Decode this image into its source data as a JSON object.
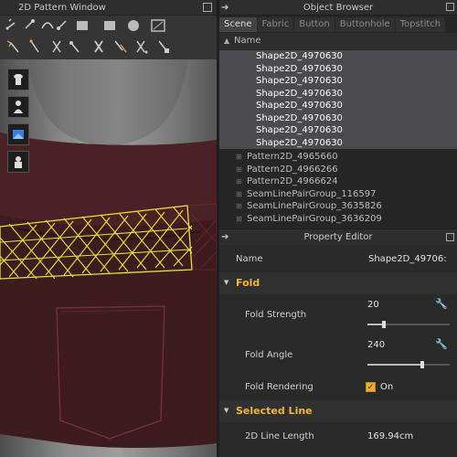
{
  "left_window": {
    "title": "2D Pattern Window"
  },
  "object_browser": {
    "title": "Object Browser",
    "tabs": [
      {
        "label": "Scene",
        "active": true
      },
      {
        "label": "Fabric",
        "active": false
      },
      {
        "label": "Button",
        "active": false
      },
      {
        "label": "Buttonhole",
        "active": false
      },
      {
        "label": "Topstitch",
        "active": false
      }
    ],
    "column_header": "Name",
    "selected_items": [
      "Shape2D_4970630",
      "Shape2D_4970630",
      "Shape2D_4970630",
      "Shape2D_4970630",
      "Shape2D_4970630",
      "Shape2D_4970630",
      "Shape2D_4970630",
      "Shape2D_4970630"
    ],
    "items": [
      "Pattern2D_4965660",
      "Pattern2D_4966266",
      "Pattern2D_4966624",
      "SeamLinePairGroup_116597",
      "SeamLinePairGroup_3635826",
      "SeamLinePairGroup_3636209"
    ]
  },
  "property_editor": {
    "title": "Property Editor",
    "name_label": "Name",
    "name_value": "Shape2D_49706:",
    "fold_section": "Fold",
    "fold_strength_label": "Fold Strength",
    "fold_strength_value": "20",
    "fold_strength_fraction": 0.2,
    "fold_angle_label": "Fold Angle",
    "fold_angle_value": "240",
    "fold_angle_fraction": 0.667,
    "fold_rendering_label": "Fold Rendering",
    "fold_rendering_value": "On",
    "selected_line_section": "Selected Line",
    "line_length_label": "2D Line Length",
    "line_length_value": "169.94cm"
  },
  "colors": {
    "accent": "#f0b63c",
    "selection": "#4a4a4f",
    "garment": "#3d1b1e",
    "pattern_lines": "#e8e23a"
  }
}
